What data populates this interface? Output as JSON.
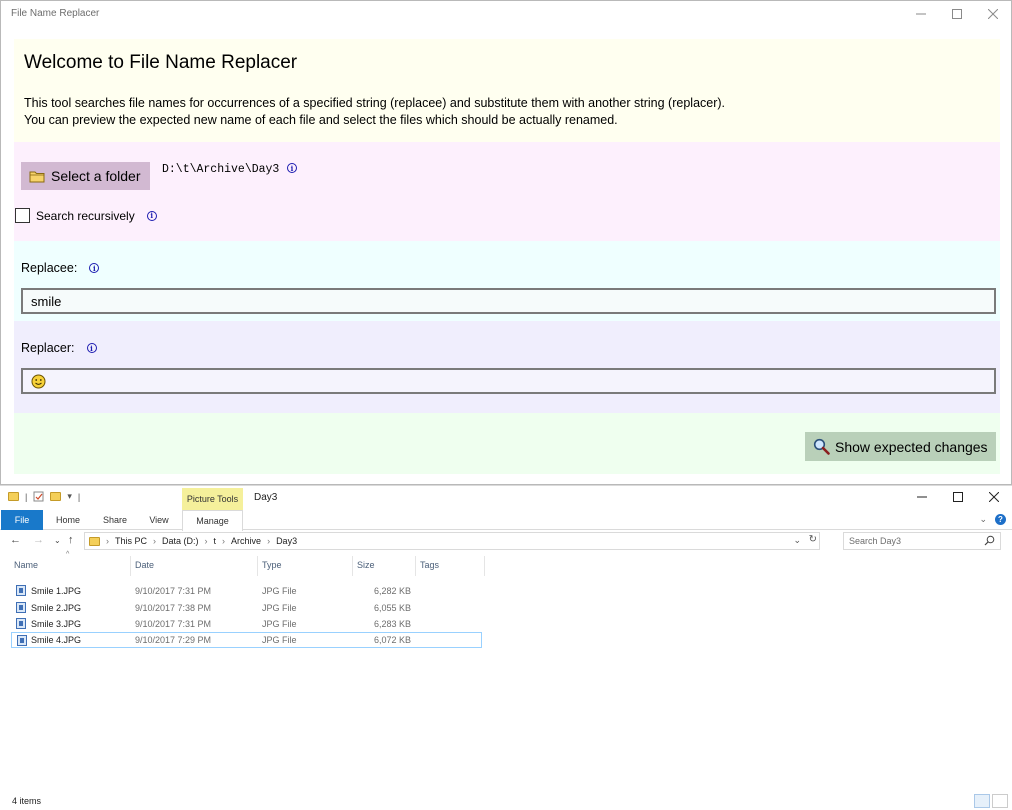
{
  "app": {
    "title": "File Name Replacer",
    "welcome": {
      "heading": "Welcome to File Name Replacer",
      "line1": "This tool searches file names for occurrences of a specified string (replacee) and substitute them with another string (replacer).",
      "line2": "You can preview the expected new name of each file and select the files which should be actually renamed."
    },
    "folder": {
      "button_label": "Select a folder",
      "path": "D:\\t\\Archive\\Day3",
      "recursive_label": "Search recursively",
      "recursive_checked": false
    },
    "replacee": {
      "label": "Replacee:",
      "value": "smile"
    },
    "replacer": {
      "label": "Replacer:",
      "value": "🙂"
    },
    "actions": {
      "show_label": "Show expected changes"
    },
    "colors": {
      "welcome_bg": "#fffff0",
      "folder_bg": "#fdf0fd",
      "replacee_bg": "#efffff",
      "replacer_bg": "#f0eefd",
      "actions_bg": "#efffef",
      "folder_button": "#d2b9d2",
      "show_button": "#b9d0b9"
    }
  },
  "explorer": {
    "title": "Day3",
    "context_tab_group": "Picture Tools",
    "tabs": {
      "file": "File",
      "home": "Home",
      "share": "Share",
      "view": "View",
      "manage": "Manage"
    },
    "breadcrumb": [
      "This PC",
      "Data (D:)",
      "t",
      "Archive",
      "Day3"
    ],
    "search_placeholder": "Search Day3",
    "columns": {
      "name": "Name",
      "date": "Date",
      "type": "Type",
      "size": "Size",
      "tags": "Tags"
    },
    "files": [
      {
        "name": "Smile 1.JPG",
        "date": "9/10/2017 7:31 PM",
        "type": "JPG File",
        "size": "6,282 KB"
      },
      {
        "name": "Smile 2.JPG",
        "date": "9/10/2017 7:38 PM",
        "type": "JPG File",
        "size": "6,055 KB"
      },
      {
        "name": "Smile 3.JPG",
        "date": "9/10/2017 7:31 PM",
        "type": "JPG File",
        "size": "6,283 KB"
      },
      {
        "name": "Smile 4.JPG",
        "date": "9/10/2017 7:29 PM",
        "type": "JPG File",
        "size": "6,072 KB"
      }
    ],
    "status": "4 items",
    "icons": {
      "folder": "folder-icon",
      "search": "search-icon",
      "info": "info-icon",
      "help": "help-icon",
      "jpg": "jpg-file-icon"
    }
  }
}
